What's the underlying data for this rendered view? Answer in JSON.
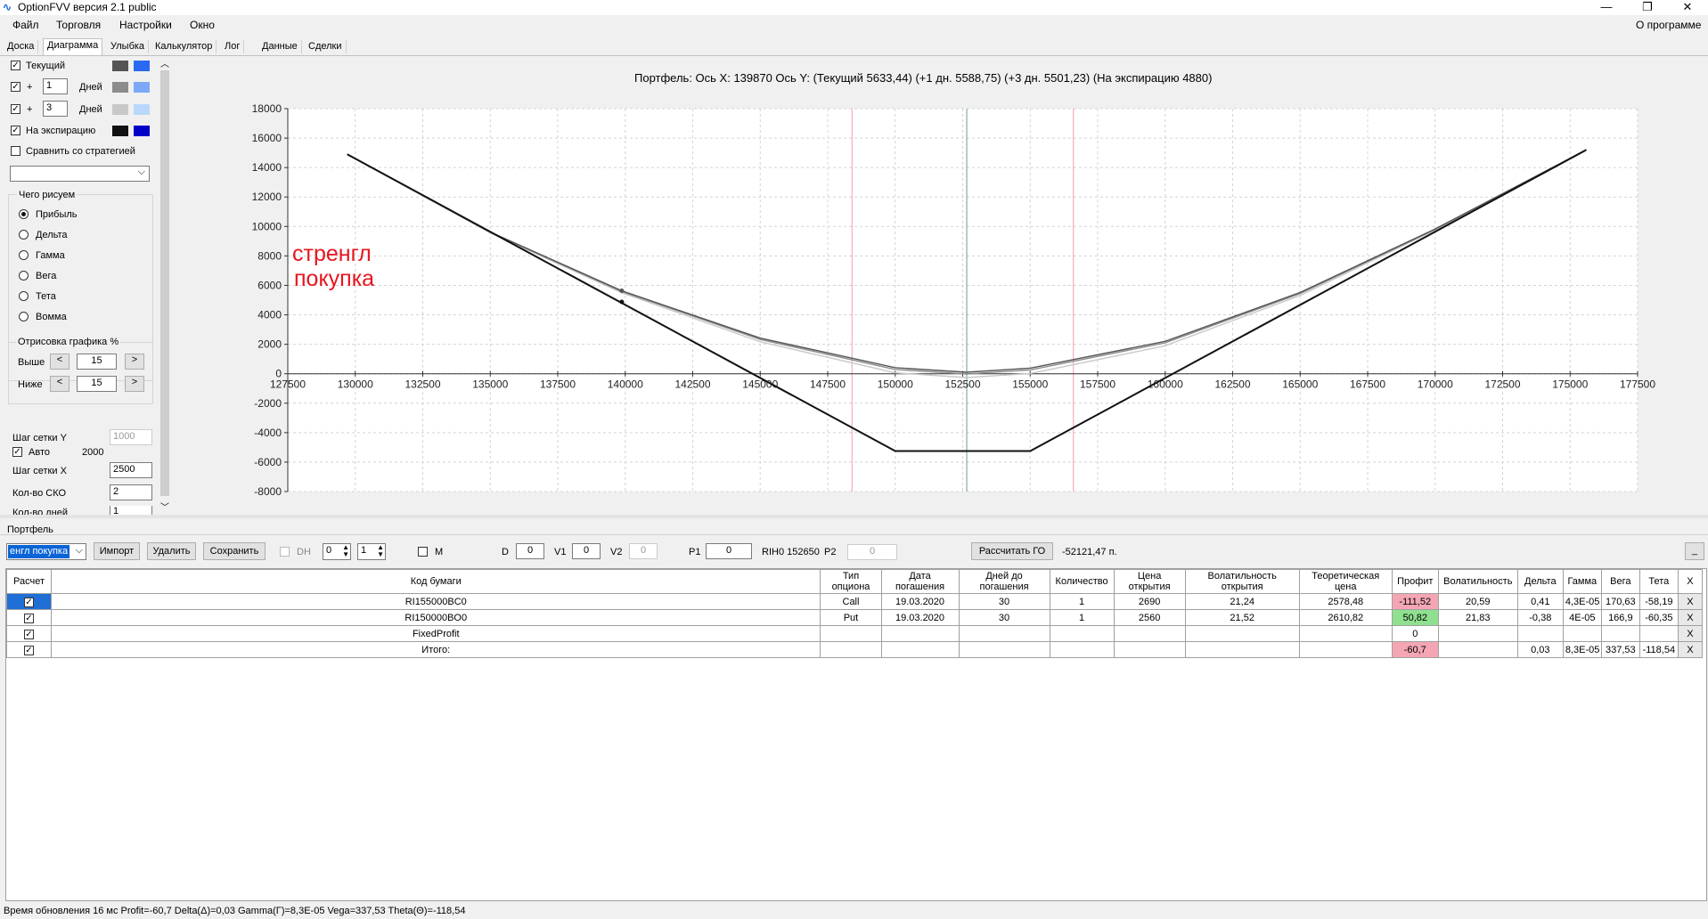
{
  "window": {
    "title": "OptionFVV версия 2.1 public",
    "minimize": "—",
    "restore": "❐",
    "close": "✕"
  },
  "menu": {
    "file": "Файл",
    "trade": "Торговля",
    "settings": "Настройки",
    "window": "Окно",
    "about": "О программе"
  },
  "tabs": [
    "Доска",
    "Диаграмма",
    "Улыбка",
    "Калькулятор",
    "Лог",
    "Данные",
    "Сделки"
  ],
  "left": {
    "current": "Текущий",
    "plus": "+",
    "days": "Дней",
    "days1_value": "1",
    "days3_value": "3",
    "expiry": "На экспирацию",
    "compare": "Сравнить со стратегией",
    "what_group": "Чего рисуем",
    "radios": [
      "Прибыль",
      "Дельта",
      "Гамма",
      "Вега",
      "Тета",
      "Вомма"
    ],
    "draw_group": "Отрисовка графика %",
    "above": "Выше",
    "below": "Ниже",
    "above_value": "15",
    "below_value": "15",
    "dec": "<",
    "inc": ">",
    "grid_y": "Шаг сетки Y",
    "grid_y_value": "1000",
    "auto": "Авто",
    "auto_value": "2000",
    "grid_x": "Шаг сетки X",
    "grid_x_value": "2500",
    "sko": "Кол-во СКО",
    "sko_value": "2",
    "cut_label": "Кол-во дней",
    "cut_value": "1"
  },
  "colors": {
    "current": [
      "#555555",
      "#2a6af0"
    ],
    "plus1": [
      "#8c8c8c",
      "#7ba9f5"
    ],
    "plus3": [
      "#c8c8c8",
      "#b9d8fb"
    ],
    "expiry": [
      "#111111",
      "#0000c8"
    ]
  },
  "chart_header": "Портфель: Ось X: 139870 Ось Y:  (Текущий 5633,44)  (+1 дн. 5588,75)  (+3 дн. 5501,23)  (На экспирацию 4880)",
  "chart_data": {
    "type": "line",
    "xlim": [
      127500,
      177500
    ],
    "ylim": [
      -8000,
      18000
    ],
    "x_ticks": [
      127500,
      130000,
      132500,
      135000,
      137500,
      140000,
      142500,
      145000,
      147500,
      150000,
      152500,
      155000,
      157500,
      160000,
      162500,
      165000,
      167500,
      170000,
      172500,
      175000,
      177500
    ],
    "y_ticks": [
      18000,
      16000,
      14000,
      12000,
      10000,
      8000,
      6000,
      4000,
      2000,
      0,
      -2000,
      -4000,
      -6000,
      -8000
    ],
    "annotation": [
      "стренгл",
      "покупка"
    ],
    "vlines": [
      {
        "x": 148400,
        "color": "#f0a0a8"
      },
      {
        "x": 152650,
        "color": "#6a9a9a"
      },
      {
        "x": 156600,
        "color": "#f0a0a8"
      }
    ],
    "cursor_x": 139870,
    "series": [
      {
        "color": "#111111",
        "points": [
          [
            129700,
            14900
          ],
          [
            150000,
            -5250
          ],
          [
            155000,
            -5250
          ],
          [
            175600,
            15200
          ]
        ]
      },
      {
        "color": "#555555",
        "points": [
          [
            129700,
            14900
          ],
          [
            135000,
            9620
          ],
          [
            139870,
            5633
          ],
          [
            145000,
            2420
          ],
          [
            150000,
            410
          ],
          [
            152650,
            100
          ],
          [
            155000,
            380
          ],
          [
            160000,
            2200
          ],
          [
            165000,
            5520
          ],
          [
            170000,
            9830
          ],
          [
            175600,
            15200
          ]
        ]
      },
      {
        "color": "#8c8c8c",
        "points": [
          [
            129700,
            14900
          ],
          [
            135000,
            9600
          ],
          [
            139870,
            5589
          ],
          [
            145000,
            2330
          ],
          [
            150000,
            290
          ],
          [
            152650,
            -20
          ],
          [
            155000,
            260
          ],
          [
            160000,
            2100
          ],
          [
            165000,
            5450
          ],
          [
            170000,
            9800
          ],
          [
            175600,
            15200
          ]
        ]
      },
      {
        "color": "#c8c8c8",
        "points": [
          [
            129700,
            14900
          ],
          [
            135000,
            9560
          ],
          [
            139870,
            5501
          ],
          [
            145000,
            2170
          ],
          [
            150000,
            60
          ],
          [
            152650,
            -260
          ],
          [
            155000,
            20
          ],
          [
            160000,
            1900
          ],
          [
            165000,
            5320
          ],
          [
            170000,
            9750
          ],
          [
            175600,
            15200
          ]
        ]
      }
    ],
    "markers": [
      {
        "x": 139870,
        "y": 5633,
        "color": "#555555"
      },
      {
        "x": 139870,
        "y": 4880,
        "color": "#111111"
      }
    ]
  },
  "portfolio": {
    "label": "Портфель",
    "name": "енгл покупка",
    "import": "Импорт",
    "delete": "Удалить",
    "save": "Сохранить",
    "dh": "DH",
    "spin1": "0",
    "spin2": "1",
    "m": "M",
    "d_label": "D",
    "d_value": "0",
    "v1_label": "V1",
    "v1_value": "0",
    "v2_label": "V2",
    "v2_value": "0",
    "p1_label": "P1",
    "p1_value": "0",
    "rih": "RIH0 152650",
    "p2_label": "P2",
    "p2_value": "0",
    "calc_go": "Рассчитать ГО",
    "go_value": "-52121,47 п.",
    "collapse": "_"
  },
  "table": {
    "headers": [
      "Расчет",
      "Код бумаги",
      "Тип опциона",
      "Дата погашения",
      "Дней до погашения",
      "Количество",
      "Цена открытия",
      "Волатильность открытия",
      "Теоретическая цена",
      "Профит",
      "Волатильность",
      "Дельта",
      "Гамма",
      "Вега",
      "Тета",
      "X"
    ],
    "rows": [
      [
        "RI155000BC0",
        "Call",
        "19.03.2020",
        "30",
        "1",
        "2690",
        "21,24",
        "2578,48",
        "-111,52",
        "20,59",
        "0,41",
        "4,3E-05",
        "170,63",
        "-58,19",
        "X"
      ],
      [
        "RI150000BO0",
        "Put",
        "19.03.2020",
        "30",
        "1",
        "2560",
        "21,52",
        "2610,82",
        "50,82",
        "21,83",
        "-0,38",
        "4E-05",
        "166,9",
        "-60,35",
        "X"
      ],
      [
        "FixedProfit",
        "",
        "",
        "",
        "",
        "",
        "",
        "",
        "0",
        "",
        "",
        "",
        "",
        "",
        "X"
      ],
      [
        "Итого:",
        "",
        "",
        "",
        "",
        "",
        "",
        "",
        "-60,7",
        "",
        "0,03",
        "8,3E-05",
        "337,53",
        "-118,54",
        "X"
      ]
    ]
  },
  "status": "Время обновления 16 мс  Profit=-60,7 Delta(Δ)=0,03 Gamma(Γ)=8,3E-05 Vega=337,53 Theta(Θ)=-118,54"
}
